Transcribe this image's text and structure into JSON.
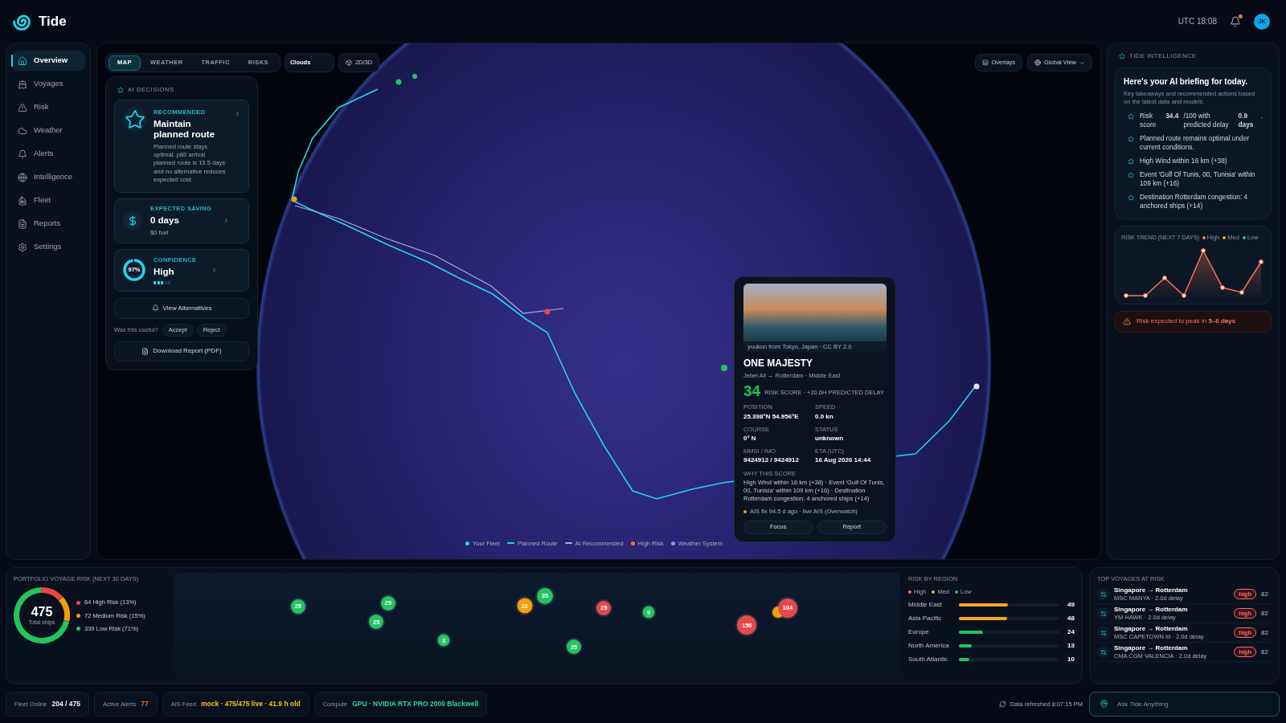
{
  "header": {
    "brand": "Tide",
    "clock": "UTC 18:08",
    "notifications": {
      "unread": true
    },
    "avatar": "JK"
  },
  "sidebar": {
    "items": [
      {
        "label": "Overview",
        "selected": true
      },
      {
        "label": "Voyages",
        "selected": false
      },
      {
        "label": "Risk",
        "selected": false
      },
      {
        "label": "Weather",
        "selected": false
      },
      {
        "label": "Alerts",
        "selected": false
      },
      {
        "label": "Intelligence",
        "selected": false
      },
      {
        "label": "Fleet",
        "selected": false
      },
      {
        "label": "Reports",
        "selected": false
      },
      {
        "label": "Settings",
        "selected": false
      }
    ]
  },
  "map": {
    "tabs": [
      {
        "label": "MAP",
        "selected": true
      },
      {
        "label": "WEATHER",
        "selected": false
      },
      {
        "label": "TRAFFIC",
        "selected": false
      },
      {
        "label": "RISKS",
        "selected": false
      }
    ],
    "clouds_button": "Clouds",
    "view_toggle": "2D/3D",
    "overlays_button": "Overlays",
    "view_select": "Global View",
    "legend": [
      {
        "label": "Your Fleet",
        "kind": "dot",
        "color": "#22d3ee"
      },
      {
        "label": "Planned Route",
        "kind": "line",
        "color": "#22d3ee"
      },
      {
        "label": "AI Recommended",
        "kind": "line",
        "color": "#9fb4d8"
      },
      {
        "label": "High Risk",
        "kind": "dot",
        "color": "#f97316"
      },
      {
        "label": "Weather System",
        "kind": "dot",
        "color": "#a78bfa"
      }
    ]
  },
  "ai_decisions": {
    "title": "AI DECISIONS",
    "recommendation": {
      "eyebrow": "RECOMMENDED",
      "title": "Maintain planned route",
      "description": "Planned route stays optimal: p80 arrival planned route is 15.5 days and no alternative reduces expected cost."
    },
    "saving": {
      "eyebrow": "EXPECTED SAVING",
      "value": "0 days",
      "sub": "$0 fuel"
    },
    "confidence": {
      "eyebrow": "CONFIDENCE",
      "value": "High",
      "ring": {
        "text": "97%",
        "level": 0.97
      },
      "meter": {
        "level": 0.6
      }
    },
    "alternatives_button": "View Alternatives",
    "feedback": {
      "prompt": "Was this useful?",
      "buttons": [
        "Accept",
        "Reject"
      ]
    },
    "download_button": "Download Report (PDF)"
  },
  "vessel_popup": {
    "photo_caption": "yuukon from Tokyo, Japan · CC BY 2.0",
    "name": "ONE MAJESTY",
    "route": "Jebel Ali → Rotterdam · Middle East",
    "score": "34",
    "score_caption": "RISK SCORE · +20.6H PREDICTED DELAY",
    "fields": [
      {
        "label": "POSITION",
        "value": "25.398°N 54.956°E"
      },
      {
        "label": "SPEED",
        "value": "0.0 kn"
      },
      {
        "label": "COURSE",
        "value": "0° N"
      },
      {
        "label": "STATUS",
        "value": "unknown"
      },
      {
        "label": "MMSI / IMO",
        "value": "9424912 / 9424912"
      },
      {
        "label": "ETA (UTC)",
        "value": "16 Aug 2026 14:44"
      }
    ],
    "why_title": "WHY THIS SCORE",
    "why_text": "High Wind within 16 km (+38) · Event 'Gulf Of Tunis, 00, Tunisia' within 109 km (+16) · Destination Rotterdam congestion: 4 anchored ships (+14)",
    "ais_note": "AIS fix 94.5 d ago · live AIS (Overwatch)",
    "buttons": [
      "Focus",
      "Report"
    ]
  },
  "intelligence": {
    "title": "TIDE INTELLIGENCE",
    "briefing": {
      "heading": "Here's your AI briefing for today.",
      "subtitle": "Key takeaways and recommended actions based on the latest data and models.",
      "items": [
        "Risk score **34.4** /100 with predicted delay **0.9 days**.",
        "Planned route remains optimal under current conditions.",
        "High Wind within 16 km (+38)",
        "Event 'Gulf Of Tunis, 00, Tunisia' within 109 km (+16)",
        "Destination Rotterdam congestion: 4 anchored ships (+14)"
      ]
    },
    "trend": {
      "title": "RISK TREND (NEXT 7 DAYS)",
      "legend": [
        {
          "label": "High",
          "color": "#f97350"
        },
        {
          "label": "Med",
          "color": "#f59e0b"
        },
        {
          "label": "Low",
          "color": "#22c55e"
        }
      ]
    },
    "alert": "Risk expected to peak in **5–6 days**"
  },
  "portfolio": {
    "title": "PORTFOLIO VOYAGE RISK (NEXT 30 DAYS)",
    "total": "475",
    "total_label": "Total ships",
    "legend": [
      {
        "label": "64 High Risk (13%)",
        "color": "#ef4444"
      },
      {
        "label": "72 Medium Risk (15%)",
        "color": "#f59e0b"
      },
      {
        "label": "339 Low Risk (71%)",
        "color": "#22c55e"
      }
    ],
    "clusters": [
      {
        "count": "25",
        "color": "#22c55e"
      },
      {
        "count": "25",
        "color": "#22c55e"
      },
      {
        "count": "25",
        "color": "#22c55e"
      },
      {
        "count": "8",
        "color": "#22c55e"
      },
      {
        "count": "22",
        "color": "#f59e0b"
      },
      {
        "count": "35",
        "color": "#22c55e"
      },
      {
        "count": "25",
        "color": "#e5484d"
      },
      {
        "count": "9",
        "color": "#22c55e"
      },
      {
        "count": "25",
        "color": "#22c55e"
      },
      {
        "count": "156",
        "color": "#e5484d"
      },
      {
        "color": "#f59e0b"
      },
      {
        "count": "104",
        "color": "#e5484d"
      }
    ]
  },
  "risk_by_region": {
    "title": "RISK BY REGION",
    "legend": [
      {
        "label": "High",
        "color": "#f97350"
      },
      {
        "label": "Med",
        "color": "#f5a524"
      },
      {
        "label": "Low",
        "color": "#22c55e"
      }
    ],
    "rows": [
      {
        "region": "Middle East",
        "value": "49",
        "level": 0.49,
        "color": "#f5a524"
      },
      {
        "region": "Asia Pacific",
        "value": "48",
        "level": 0.48,
        "color": "#f5a524"
      },
      {
        "region": "Europe",
        "value": "24",
        "level": 0.24,
        "color": "#22c55e"
      },
      {
        "region": "North America",
        "value": "13",
        "level": 0.13,
        "color": "#22c55e"
      },
      {
        "region": "South Atlantic",
        "value": "10",
        "level": 0.1,
        "color": "#22c55e"
      }
    ]
  },
  "top_voyages": {
    "title": "TOP VOYAGES AT RISK",
    "rows": [
      {
        "route": "Singapore → Rotterdam",
        "detail": "MSC MANYA · 2.0d delay",
        "badge": "high",
        "color": "#f87171",
        "score": "82"
      },
      {
        "route": "Singapore → Rotterdam",
        "detail": "YM HAWK · 2.0d delay",
        "badge": "high",
        "color": "#f87171",
        "score": "82"
      },
      {
        "route": "Singapore → Rotterdam",
        "detail": "MSC CAPETOWN III · 2.0d delay",
        "badge": "high",
        "color": "#f87171",
        "score": "82"
      },
      {
        "route": "Singapore → Rotterdam",
        "detail": "CMA CGM VALENCIA · 2.0d delay",
        "badge": "high",
        "color": "#f87171",
        "score": "82"
      }
    ]
  },
  "status_bar": {
    "items": [
      {
        "label": "Fleet Online",
        "value": "204 / 475",
        "color": "#f1f5f9"
      },
      {
        "label": "Active Alerts",
        "value": "77",
        "color": "#f97316"
      },
      {
        "label": "AIS Feed",
        "value": "mock · 475/475 live · 41.9 h old",
        "color": "#fbbf24"
      },
      {
        "label": "Compute",
        "value": "GPU · NVIDIA RTX PRO 2000 Blackwell",
        "color": "#34d399"
      }
    ],
    "refreshed": "Data refreshed 8:07:15 PM",
    "ask": {
      "placeholder": "Ask Tide Anything"
    }
  }
}
